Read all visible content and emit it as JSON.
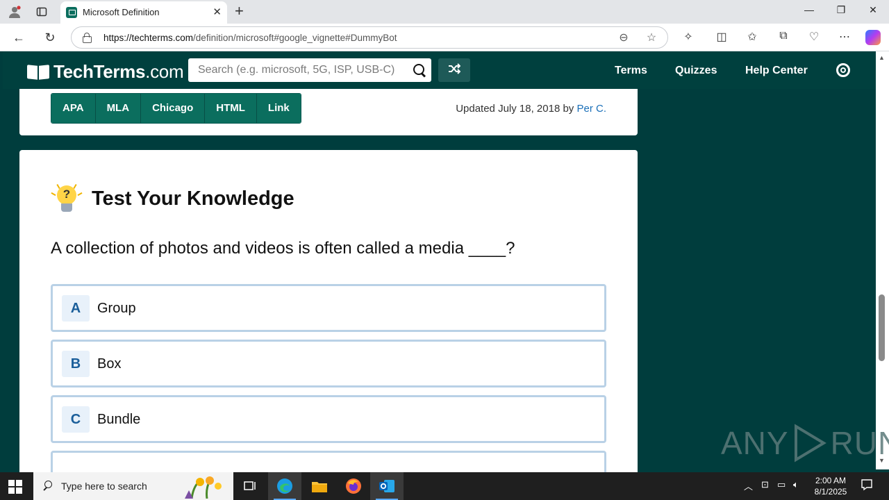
{
  "browser": {
    "tab_title": "Microsoft Definition",
    "url_host": "https://techterms.com",
    "url_path": "/definition/microsoft#google_vignette#DummyBot"
  },
  "site": {
    "logo_main": "TechTerms",
    "logo_suffix": ".com",
    "search_placeholder": "Search (e.g. microsoft, 5G, ISP, USB-C)",
    "nav": [
      "Terms",
      "Quizzes",
      "Help Center"
    ]
  },
  "citation": {
    "buttons": [
      "APA",
      "MLA",
      "Chicago",
      "HTML",
      "Link"
    ],
    "updated_prefix": "Updated July 18, 2018 by",
    "author": "Per C."
  },
  "quiz": {
    "title": "Test Your Knowledge",
    "question": "A collection of photos and videos is often called a media ____?",
    "options": [
      {
        "letter": "A",
        "text": "Group"
      },
      {
        "letter": "B",
        "text": "Box"
      },
      {
        "letter": "C",
        "text": "Bundle"
      }
    ]
  },
  "watermark": {
    "left": "ANY",
    "right": "RUN"
  },
  "taskbar": {
    "search_placeholder": "Type here to search",
    "time": "2:00 AM",
    "date": "8/1/2025"
  },
  "colors": {
    "site_bg": "#003d3d",
    "button_green": "#0b6e5e",
    "option_border": "#b9d1e6",
    "link_blue": "#1a6fb8"
  }
}
